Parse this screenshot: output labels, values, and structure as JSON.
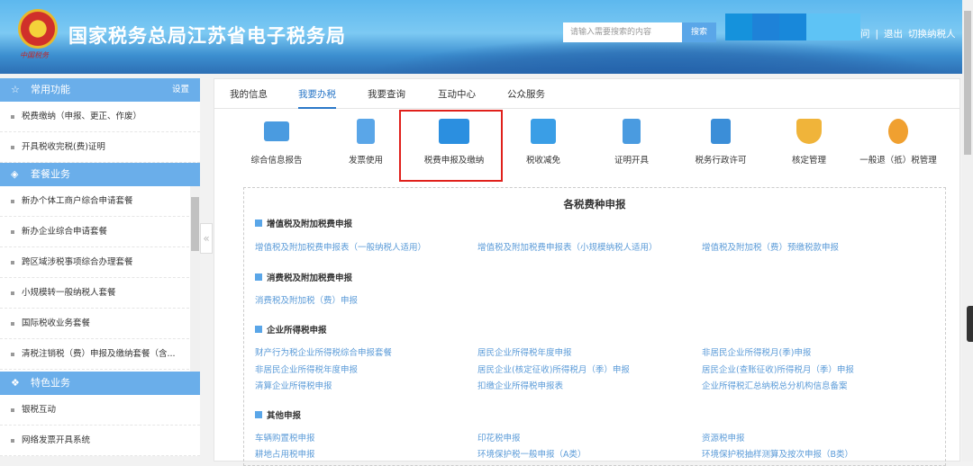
{
  "header": {
    "title": "国家税务总局江苏省电子税务局",
    "logo_text": "中国税务",
    "search_placeholder": "请输入需要搜索的内容",
    "search_button": "搜索",
    "links": [
      "问",
      "|",
      "退出",
      "切换纳税人"
    ]
  },
  "colors": {
    "header": "#5db8ee",
    "sidebar_header": "#6aaeea",
    "link": "#5b9bd8",
    "accent": "#2b78c8",
    "highlight": "#e0201b"
  },
  "sidebar": {
    "common": {
      "title": "常用功能",
      "settings": "设置",
      "items": [
        "税费缴纳（申报、更正、作废）",
        "开具税收完税(费)证明"
      ]
    },
    "package": {
      "title": "套餐业务",
      "items": [
        "新办个体工商户综合申请套餐",
        "新办企业综合申请套餐",
        "跨区域涉税事项综合办理套餐",
        "小规模转一般纳税人套餐",
        "国际税收业务套餐",
        "清税注销税（费）申报及缴纳套餐（含..."
      ]
    },
    "special": {
      "title": "特色业务",
      "items": [
        "银税互动",
        "网络发票开具系统"
      ]
    },
    "collapse": "«"
  },
  "tabs": [
    "我的信息",
    "我要办税",
    "我要查询",
    "互动中心",
    "公众服务"
  ],
  "functions": [
    "综合信息报告",
    "发票使用",
    "税费申报及缴纳",
    "税收减免",
    "证明开具",
    "税务行政许可",
    "核定管理",
    "一般退（抵）税管理"
  ],
  "content": {
    "title": "各税费种申报",
    "sections": [
      {
        "title": "增值税及附加税费申报",
        "links": [
          "增值税及附加税费申报表（一般纳税人适用）",
          "增值税及附加税费申报表（小规模纳税人适用）",
          "增值税及附加税（费）预缴税款申报"
        ]
      },
      {
        "title": "消费税及附加税费申报",
        "links": [
          "消费税及附加税（费）申报"
        ]
      },
      {
        "title": "企业所得税申报",
        "links": [
          "财产行为税企业所得税综合申报套餐",
          "居民企业所得税年度申报",
          "非居民企业所得税月(季)申报",
          "非居民企业所得税年度申报",
          "居民企业(核定征收)所得税月（季）申报",
          "居民企业(查账征收)所得税月（季）申报",
          "清算企业所得税申报",
          "扣缴企业所得税申报表",
          "企业所得税汇总纳税总分机构信息备案"
        ]
      },
      {
        "title": "其他申报",
        "links": [
          "车辆购置税申报",
          "印花税申报",
          "资源税申报",
          "耕地占用税申报",
          "环境保护税一般申报（A类）",
          "环境保护税抽样测算及按次申报（B类）"
        ]
      }
    ]
  }
}
